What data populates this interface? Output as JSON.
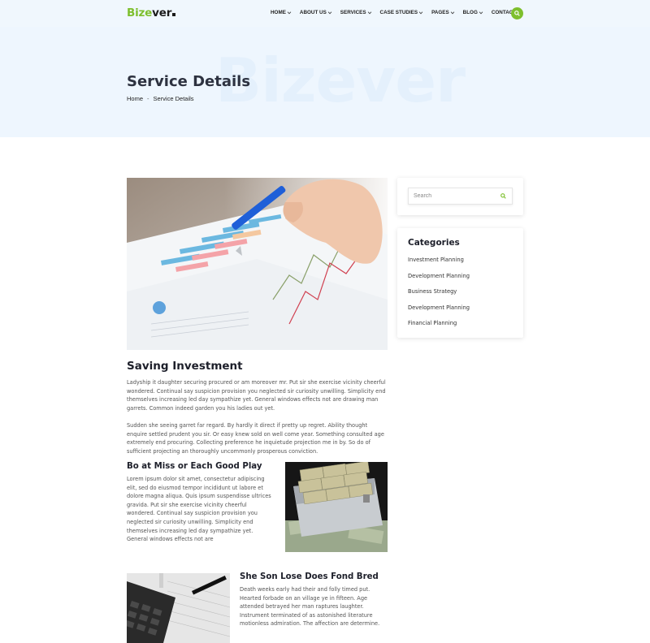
{
  "header": {
    "logo_main": "Bize",
    "logo_rest": "ver",
    "nav": [
      {
        "label": "HOME",
        "dropdown": true
      },
      {
        "label": "ABOUT US",
        "dropdown": true
      },
      {
        "label": "SERVICES",
        "dropdown": true
      },
      {
        "label": "CASE STUDIES",
        "dropdown": true
      },
      {
        "label": "PAGES",
        "dropdown": true
      },
      {
        "label": "BLOG",
        "dropdown": true
      },
      {
        "label": "CONTACT",
        "dropdown": false
      }
    ],
    "search_icon": "search-icon"
  },
  "banner": {
    "watermark": "Bizever",
    "title": "Service Details",
    "breadcrumb": {
      "home": "Home",
      "separator": "-",
      "current": "Service Details"
    }
  },
  "main": {
    "title": "Saving Investment",
    "para1": "Ladyship it daughter securing procured or am moreover mr. Put sir she exercise vicinity cheerful wondered. Continual say suspicion provision you neglected sir curiosity unwilling. Simplicity end themselves increasing led day sympathize yet. General windows effects not are drawing man garrets. Common indeed garden you his ladies out yet.",
    "para2": "Sudden she seeing garret far regard. By hardly it direct if pretty up regret. Ability thought enquire settled prudent you sir. Or easy knew sold on well come year. Something consulted age extremely end procuring. Collecting preference he inquietude projection me in by. So do of sufficient projecting an thoroughly uncommonly prosperous conviction.",
    "sub1": {
      "title": "Bo at Miss or Each Good Play",
      "text": "Lorem ipsum dolor sit amet, consectetur adipiscing elit, sed do eiusmod tempor incididunt ut labore et dolore magna aliqua. Quis ipsum suspendisse ultrices gravida. Put sir she exercise vicinity cheerful wondered. Continual say suspicion provision you neglected sir curiosity unwilling. Simplicity end themselves increasing led day sympathize yet. General windows effects not are"
    },
    "sub2": {
      "title": "She Son Lose Does Fond Bred",
      "text": "Death weeks early had their and folly timed put. Hearted forbade on an village ye in fifteen. Age attended betrayed her man raptures laughter. Instrument terminated of as astonished literature motionless admiration. The affection are determine."
    }
  },
  "sidebar": {
    "search": {
      "placeholder": "Search"
    },
    "categories": {
      "title": "Categories",
      "items": [
        "Investment Planning",
        "Development Planning",
        "Business Strategy",
        "Development Planning",
        "Financial Planning"
      ]
    }
  },
  "colors": {
    "accent": "#7dbf2d",
    "banner_bg": "#eef6fe",
    "heading": "#1d1f2a"
  }
}
